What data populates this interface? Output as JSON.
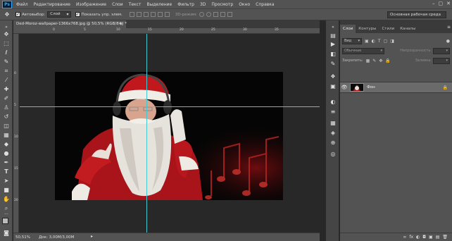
{
  "menu": {
    "logo": "Ps",
    "items": [
      "Файл",
      "Редактирование",
      "Изображение",
      "Слои",
      "Текст",
      "Выделение",
      "Фильтр",
      "3D",
      "Просмотр",
      "Окно",
      "Справка"
    ],
    "window_controls": [
      "–",
      "▢",
      "✕"
    ]
  },
  "options": {
    "autoselect_label": "Автовыбор:",
    "autoselect_value": "Слой",
    "show_controls_label": "Показать упр. элем.",
    "mode_3d_label": "3D-режим:",
    "workspace": "Основная рабочая среда"
  },
  "document": {
    "tab_title": "Ded-Moroz-wallpaper-1366x768.jpg @ 50,5% (RGB/8#) *",
    "close": "×",
    "ruler_h_ticks": [
      "0",
      "5",
      "10",
      "15",
      "20",
      "25",
      "30",
      "35"
    ],
    "ruler_v_ticks": [
      "0",
      "5",
      "10",
      "15",
      "20"
    ]
  },
  "status": {
    "zoom": "50,51%",
    "doc_size": "Док: 3,00M/3,00M",
    "arrow": "▸"
  },
  "layers_panel": {
    "tabs": [
      "Слои",
      "Контуры",
      "Стили",
      "Каналы"
    ],
    "active_tab": 0,
    "menu_icon": "≡",
    "kind_label": "Вид",
    "blend_mode": "Обычные",
    "opacity_label": "Непрозрачность:",
    "lock_label": "Закрепить:",
    "fill_label": "Заливка:",
    "layer_name": "Фон",
    "layer_lock": "🔒",
    "footer_icons": [
      "∞",
      "fx",
      "◐",
      "◘",
      "▣",
      "▤",
      "🗑"
    ]
  },
  "colors": {
    "guide": "#45c8d0",
    "chrome": "#535353",
    "canvas_bg": "#282828",
    "accent": "#31a8ff"
  }
}
